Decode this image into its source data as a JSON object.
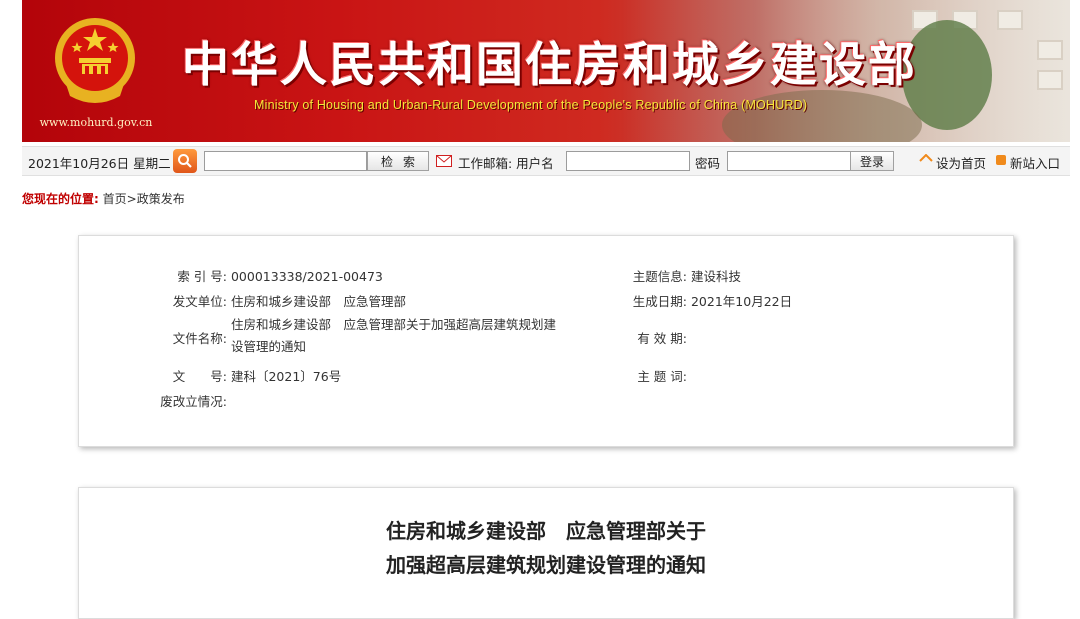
{
  "header": {
    "site_title": "中华人民共和国住房和城乡建设部",
    "subtitle": "Ministry of Housing and Urban-Rural Development of the People's Republic of China (MOHURD)",
    "url": "www.mohurd.gov.cn",
    "emblem_icon": "national-emblem-icon",
    "colors": {
      "banner_red": "#c91414",
      "title_text": "#ffffff",
      "subtitle_text": "#f7e63a"
    }
  },
  "toolbar": {
    "date": "2021年10月26日 星期二",
    "search_icon": "search-icon",
    "search_placeholder": "",
    "search_button": "检索",
    "mail_icon": "mail-icon",
    "mail_label": "工作邮箱: 用户名",
    "password_label": "密码",
    "login_button": "登录",
    "home_icon": "home-icon",
    "set_home": "设为首页",
    "new_site_icon": "new-site-icon",
    "new_site": "新站入口"
  },
  "breadcrumb": {
    "label": "您现在的位置:",
    "home": "首页",
    "separator": ">",
    "current": "政策发布"
  },
  "info": {
    "index_label": "索 引 号:",
    "index_value": "000013338/2021-00473",
    "issuer_label": "发文单位:",
    "issuer_value": "住房和城乡建设部　应急管理部",
    "filename_label": "文件名称:",
    "filename_value": "住房和城乡建设部　应急管理部关于加强超高层建筑规划建设管理的通知",
    "docno_label": "文　　号:",
    "docno_value": "建科〔2021〕76号",
    "status_label": "废改立情况:",
    "status_value": "",
    "topic_label": "主题信息:",
    "topic_value": "建设科技",
    "date_label": "生成日期:",
    "date_value": "2021年10月22日",
    "validity_label": "有 效 期:",
    "validity_value": "",
    "keywords_label": "主 题 词:",
    "keywords_value": ""
  },
  "document": {
    "title_line1": "住房和城乡建设部　应急管理部关于",
    "title_line2": "加强超高层建筑规划建设管理的通知"
  }
}
